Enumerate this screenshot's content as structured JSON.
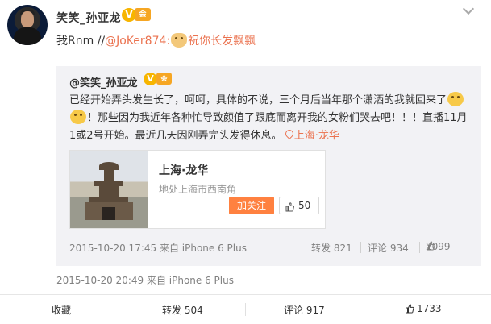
{
  "post": {
    "username": "笑笑_孙亚龙",
    "verified_badge": "V",
    "vip_badge": "会",
    "content_prefix": "我Rnm //",
    "content_mention": "@JoKer874:",
    "content_suffix": "祝你长发飘飘",
    "time_source": "2015-10-20 20:49 来自 iPhone 6 Plus"
  },
  "retweet": {
    "author": "@笑笑_孙亚龙",
    "verified_badge": "V",
    "vip_badge": "会",
    "text_part1": "已经开始弄头发生长了，呵呵，具体的不说，三个月后当年那个潇洒的我就回来了",
    "text_part2": "！那些因为我近年各种忙导致颜值了跟底而离开我的女粉们哭去吧！！！直播11月1或2号开始。最近几天因刚弄完头发得休息。",
    "location_tag": "上海·龙华",
    "card": {
      "title": "上海·龙华",
      "description": "地处上海市西南角",
      "follow_label": "加关注",
      "like_count": "50"
    },
    "time_source": "2015-10-20 17:45 来自 iPhone 6 Plus",
    "repost": "转发 821",
    "comment": "评论 934",
    "like": "2099"
  },
  "footer": {
    "favorite": "收藏",
    "repost": "转发 504",
    "comment": "评论 917",
    "like": "1733"
  },
  "icons": [
    "avatar",
    "verified-badge-icon",
    "vip-badge-icon",
    "chevron-down-icon",
    "smiley-icon",
    "cat-face-icon",
    "location-pin-icon",
    "thumbs-up-icon"
  ],
  "colors": {
    "mention": "#eb7350",
    "follow_button": "#ff8140",
    "badge": "#f7b500",
    "retweet_bg": "#f2f2f5"
  }
}
